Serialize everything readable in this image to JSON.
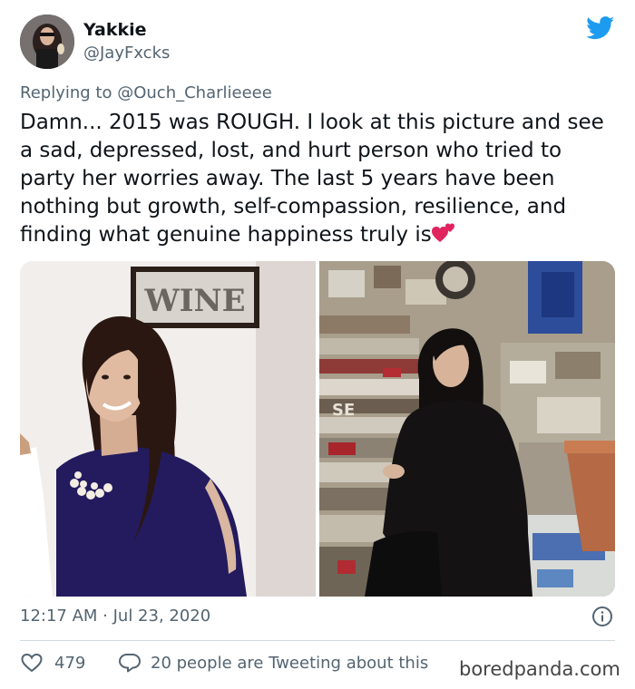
{
  "tweet": {
    "author_name": "Yakkie",
    "author_handle": "@JayFxcks",
    "replying_prefix": "Replying to",
    "replying_to": "@Ouch_Charlieeee",
    "text": "Damn... 2015 was ROUGH. I look at this picture and see a sad, depressed, lost, and hurt person who tried to party her worries away. The last 5 years have been nothing but growth, self-compassion, resilience, and finding what genuine happiness truly is",
    "emoji": "two-hearts",
    "timestamp": "12:17 AM · Jul 23, 2020",
    "likes": "479",
    "tweeting_text": "20 people are Tweeting about this"
  },
  "photos": {
    "left_sign": "WINE",
    "right_wall_text": "SE"
  },
  "watermark": "boredpanda.com",
  "colors": {
    "twitter_blue": "#1d9bf0",
    "secondary_text": "#536471",
    "heart_pink": "#e0245e"
  },
  "icons": [
    "twitter-bird-icon",
    "info-icon",
    "heart-outline-icon",
    "speech-bubble-icon",
    "two-hearts-icon"
  ]
}
